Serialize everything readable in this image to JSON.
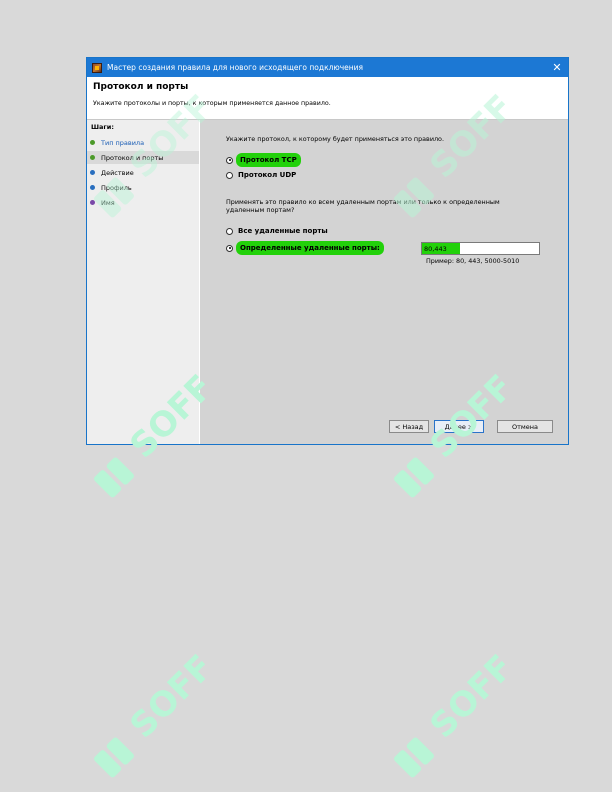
{
  "window": {
    "title": "Мастер создания правила для нового исходящего подключения",
    "close_glyph": "✕"
  },
  "header": {
    "title": "Протокол и порты",
    "subtitle": "Укажите протоколы и порты, к которым применяется данное правило."
  },
  "steps": {
    "label": "Шаги:",
    "items": [
      {
        "label": "Тип правила",
        "state": "link"
      },
      {
        "label": "Протокол и порты",
        "state": "current"
      },
      {
        "label": "Действие",
        "state": "pending"
      },
      {
        "label": "Профиль",
        "state": "pending"
      },
      {
        "label": "Имя",
        "state": "pending"
      }
    ]
  },
  "protocol": {
    "prompt": "Укажите протокол, к которому будет применяться это правило.",
    "tcp_label": "Протокол TCP",
    "udp_label": "Протокол UDP",
    "selected": "tcp"
  },
  "ports": {
    "prompt": "Применять это правило ко всем удаленным портам или только к определенным удаленным портам?",
    "all_label": "Все удаленные порты",
    "specific_label": "Определенные удаленные порты:",
    "value": "80,443",
    "example": "Пример: 80, 443, 5000-5010",
    "selected": "specific"
  },
  "buttons": {
    "back": "< Назад",
    "next": "Далее >",
    "cancel": "Отмена"
  },
  "colors": {
    "highlight": "#22d10a",
    "titlebar": "#1c78d4",
    "watermark": "#b8f5d6"
  },
  "watermark_text": "SOFF"
}
